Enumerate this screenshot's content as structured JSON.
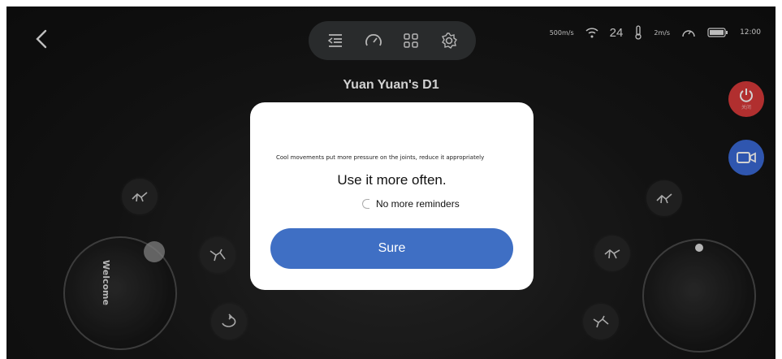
{
  "header": {
    "title": "Yuan Yuan's D1"
  },
  "status_bar": {
    "speed_1": "500m/s",
    "signal_value": "24",
    "speed_2": "2m/s",
    "time": "12:00"
  },
  "joystick_left": {
    "label": "Welcome"
  },
  "side_buttons": {
    "power_label": "关闭"
  },
  "dialog": {
    "warning_text": "Cool movements put more pressure on the joints, reduce it appropriately",
    "headline": "Use it more often.",
    "checkbox_label": "No more reminders",
    "confirm_label": "Sure"
  },
  "colors": {
    "power_red": "#d83a3a",
    "camera_blue": "#3a6ad6",
    "confirm_blue": "#3f6fc4"
  },
  "icons": {
    "nav": [
      "menu-icon",
      "speedometer-icon",
      "grid-icon",
      "settings-icon"
    ],
    "status": [
      "wifi-icon",
      "thermometer-icon",
      "gauge-icon",
      "battery-icon"
    ],
    "actions": [
      "pose-icon",
      "pose-icon",
      "rotate-icon",
      "pose-icon",
      "pose-icon",
      "pose-icon"
    ]
  }
}
